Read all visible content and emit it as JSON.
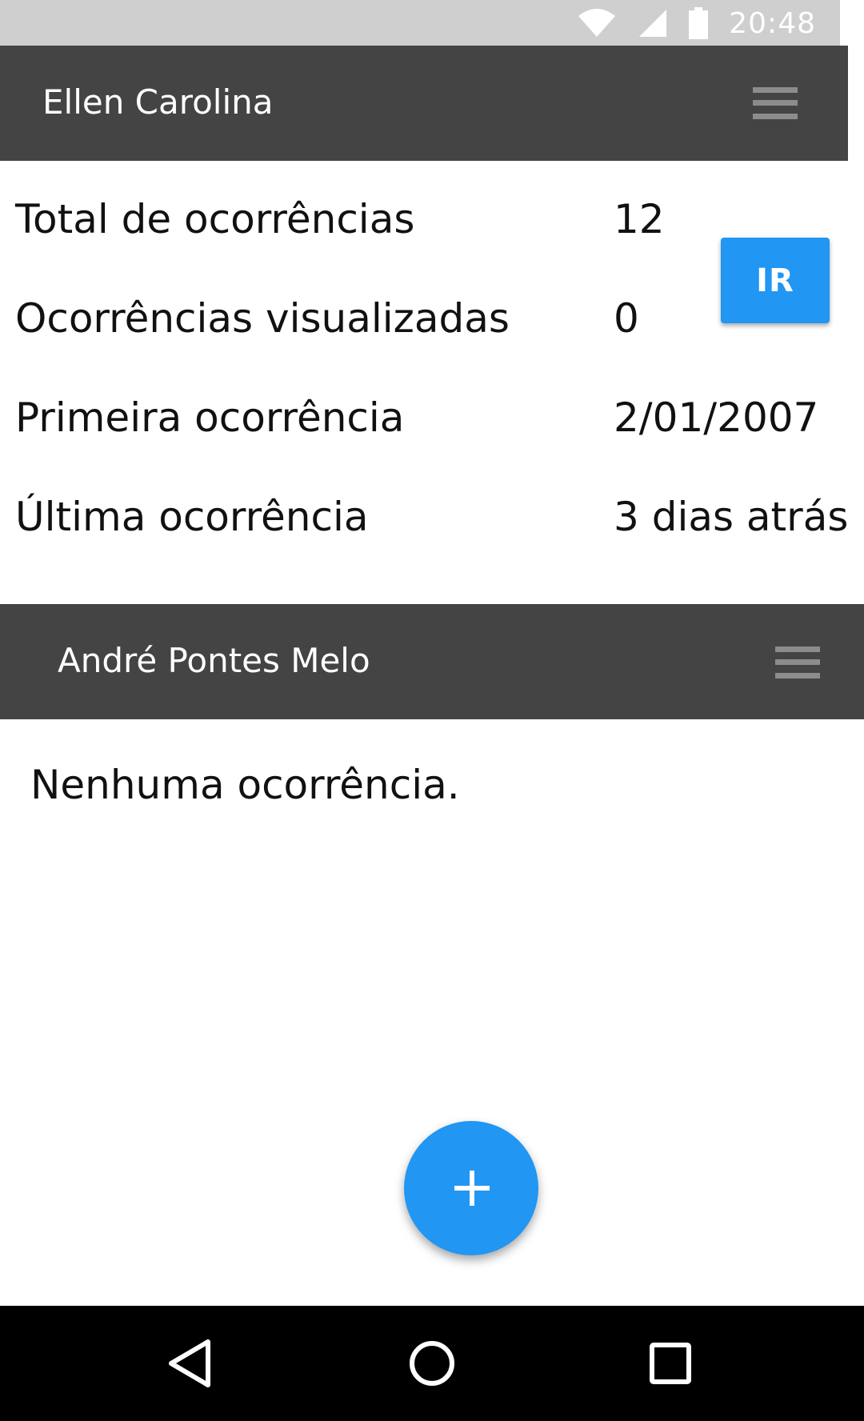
{
  "status_bar": {
    "time": "20:48",
    "icons": [
      "wifi-icon",
      "signal-icon",
      "battery-icon"
    ]
  },
  "cards": [
    {
      "name": "Ellen Carolina",
      "action_label": "IR",
      "rows": [
        {
          "label": "Total de ocorrências",
          "value": "12"
        },
        {
          "label": "Ocorrências visualizadas",
          "value": "0"
        },
        {
          "label": "Primeira ocorrência",
          "value": "2/01/2007"
        },
        {
          "label": "Última ocorrência",
          "value": "3 dias atrás"
        }
      ]
    },
    {
      "name": "André Pontes Melo",
      "empty_text": "Nenhuma ocorrência."
    }
  ],
  "fab": {
    "icon": "plus-icon"
  },
  "nav_bar": {
    "icons": [
      "back-icon",
      "home-icon",
      "recents-icon"
    ]
  },
  "colors": {
    "header_bg": "#444444",
    "accent": "#2196f3",
    "status_bg": "#cfcfcf"
  }
}
